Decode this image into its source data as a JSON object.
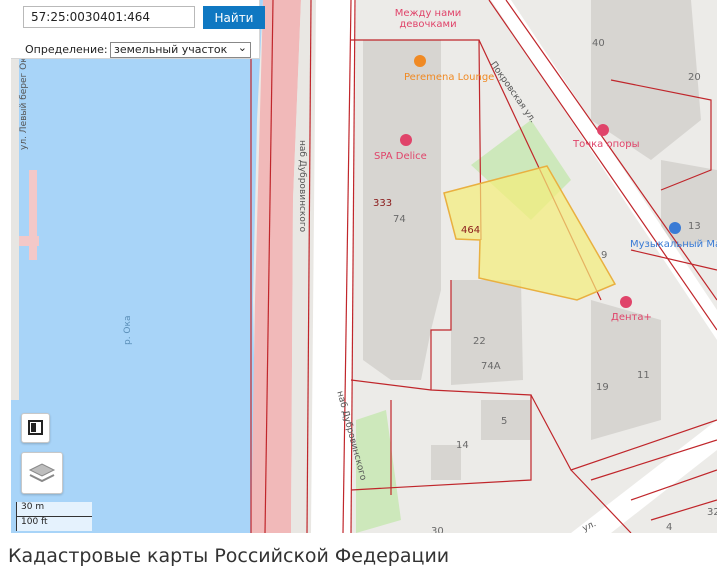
{
  "search": {
    "value": "57:25:0030401:464",
    "button_label": "Найти"
  },
  "definition": {
    "label": "Определение:",
    "selected": "земельный участок"
  },
  "map": {
    "parcel_label": "464",
    "building_numbers": [
      "40",
      "20",
      "333",
      "74",
      "13",
      "9",
      "22",
      "74А",
      "19",
      "11",
      "5",
      "14",
      "4",
      "32",
      "30"
    ],
    "streets": [
      "наб Дубровинского",
      "Покровская ул.",
      "наб Дубровинского",
      "ул. Левый берег Оки",
      "р. Ока",
      "ул."
    ],
    "pois": [
      "Между нами девочками",
      "Perеmena Lounge",
      "SPA Delice",
      "Точка опоры",
      "Музыкальный Ма",
      "Дента+"
    ]
  },
  "scale": {
    "metric": "30 m",
    "imperial": "100 ft"
  },
  "footer": {
    "title": "Кадастровые карты Российской Федерации"
  },
  "colors": {
    "water": "#a8d4f8",
    "parcel_fill": "#f5ee79",
    "parcel_stroke": "#e9b040",
    "cadastre_line": "#c0262b",
    "button": "#0f78c2"
  }
}
